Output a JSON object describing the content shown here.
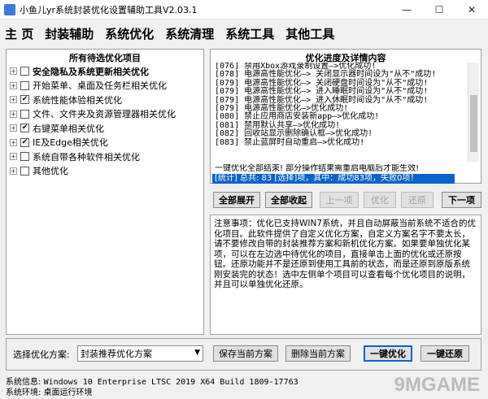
{
  "window": {
    "title": "小鱼儿yr系统封装优化设置辅助工具V2.03.1",
    "minimize": "—",
    "maximize": "☐",
    "close": "✕"
  },
  "menu": [
    "主 页",
    "封装辅助",
    "系统优化",
    "系统清理",
    "系统工具",
    "其他工具"
  ],
  "left_panel": {
    "title": "所有待选优化项目",
    "items": [
      {
        "label": "安全隐私及系统更新相关优化",
        "checked": false,
        "bold": true
      },
      {
        "label": "开始菜单、桌面及任务栏相关优化",
        "checked": false,
        "bold": false
      },
      {
        "label": "系统性能体验相关优化",
        "checked": true,
        "bold": false
      },
      {
        "label": "文件、文件夹及资源管理器相关优化",
        "checked": false,
        "bold": false
      },
      {
        "label": "右键菜单相关优化",
        "checked": true,
        "bold": false
      },
      {
        "label": "IE及Edge相关优化",
        "checked": true,
        "bold": false
      },
      {
        "label": "系统自带各种软件相关优化",
        "checked": false,
        "bold": false
      },
      {
        "label": "其他优化",
        "checked": false,
        "bold": false
      }
    ]
  },
  "right_panel": {
    "title": "优化进度及详情内容",
    "log": [
      "[076] 禁用Xbox游戏录制设置—>优化成功!",
      "[078] 电源高性能优化—> 关闭显示器时间设为\"从不\"成功!",
      "[079] 电源高性能优化—> 关闭硬盘时间设为\"从不\"成功!",
      "[079] 电源高性能优化—> 进入睡眠时间设为\"从不\"成功!",
      "[079] 电源高性能优化—> 进入休眠时间设为\"从不\"成功!",
      "[079] 电源高性能优化—>优化成功!",
      "[080] 禁止应用商店安装新app—>优化成功!",
      "[081] 禁用默认共享—>优化成功!",
      "[082] 回收站显示删除确认框—>优化成功!",
      "[083] 禁止蓝屏时自动重启—>优化成功!"
    ],
    "summary": "一键优化全部结束! 部分操作结果需重启电脑后才能生效!",
    "progress_text": "[统计] 总共: 83 [选择]项，其中：成功83项，失败0项！"
  },
  "buttons": {
    "expand_all": "全部展开",
    "collapse_all": "全部收起",
    "previous": "上一项",
    "optimize": "优化",
    "restore": "还原",
    "next": "下一项",
    "save_scheme": "保存当前方案",
    "delete_scheme": "删除当前方案",
    "one_click_optimize": "一键优化",
    "one_click_restore": "一键还原"
  },
  "notice": "注意事项：优化已支持WIN7系统，并且自动屏蔽当前系统不适合的优化项目。此软件提供了自定义优化方案，自定义方案名字不要太长，请不要修改自带的封装推荐方案和新机优化方案。如果要单独优化某项，可以在左边选中待优化的项目，直接单击上面的优化或还原按钮。还原功能并不是还原到使用工具前的状态，而是还原到原版系统刚安装完的状态！选中左侧单个项目可以查看每个优化项目的说明，并且可以单独优化还原。",
  "scheme": {
    "label": "选择优化方案:",
    "selected": "封装推荐优化方案",
    "arrow": "▼"
  },
  "system": {
    "info_label": "系统信息:",
    "info_value": "Windows 10 Enterprise LTSC 2019 X64 Build 1809-17763",
    "env_label": "系统环境:",
    "env_value": "桌面运行环境"
  },
  "watermark": "9MGAME"
}
